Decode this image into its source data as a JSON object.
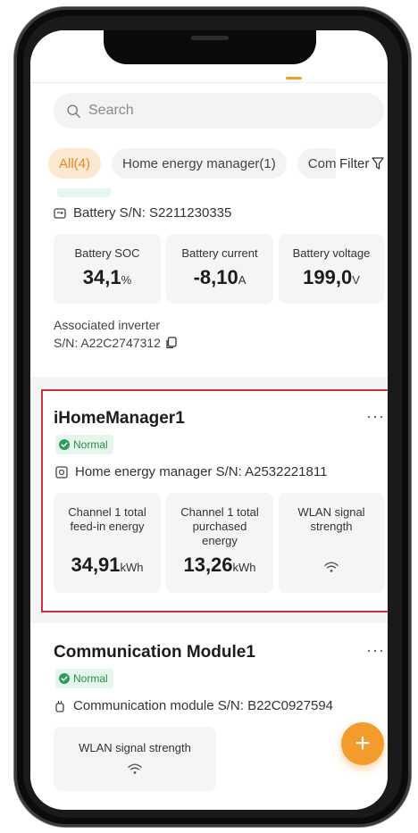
{
  "search": {
    "placeholder": "Search"
  },
  "filters": {
    "chips": [
      "All(4)",
      "Home energy manager(1)",
      "Com"
    ],
    "filter_label": "Filter"
  },
  "battery_card": {
    "serial_label": "Battery S/N: S2211230335",
    "metrics": [
      {
        "label": "Battery SOC",
        "value": "34,1",
        "unit": "%"
      },
      {
        "label": "Battery current",
        "value": "-8,10",
        "unit": "A"
      },
      {
        "label": "Battery voltage",
        "value": "199,0",
        "unit": "V"
      }
    ],
    "assoc_line1": "Associated inverter",
    "assoc_line2": "S/N: A22C2747312"
  },
  "home_manager_card": {
    "title": "iHomeManager1",
    "more": "···",
    "status": "Normal",
    "serial_label": "Home energy manager S/N: A2532221811",
    "metrics": [
      {
        "label_line1": "Channel 1 total",
        "label_line2": "feed-in energy",
        "label_line3": "",
        "value": "34,91",
        "unit": "kWh"
      },
      {
        "label_line1": "Channel 1 total",
        "label_line2": "purchased",
        "label_line3": "energy",
        "value": "13,26",
        "unit": "kWh"
      },
      {
        "label_line1": "WLAN signal",
        "label_line2": "strength",
        "label_line3": "",
        "icon": "wifi-icon"
      }
    ]
  },
  "comm_card": {
    "title": "Communication Module1",
    "more": "···",
    "status": "Normal",
    "serial_label": "Communication module S/N: B22C0927594",
    "metric_label": "WLAN signal strength",
    "icon": "wifi-icon"
  },
  "fab": {
    "label": "+"
  },
  "colors": {
    "accent": "#f39c2d",
    "status_green": "#2b8a4d",
    "highlight_border": "#c9313c"
  }
}
